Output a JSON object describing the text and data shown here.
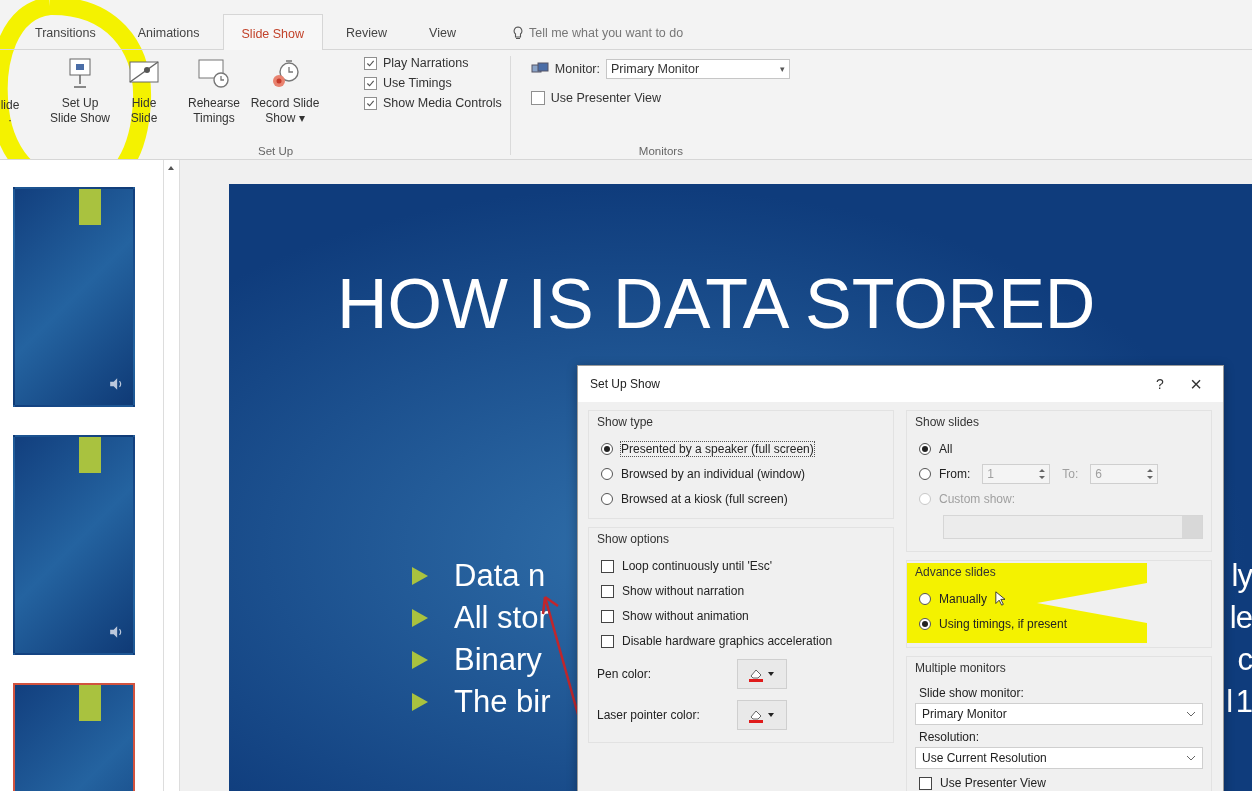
{
  "ribbon": {
    "tabs": [
      {
        "label": "Transitions",
        "selected": false
      },
      {
        "label": "Animations",
        "selected": false
      },
      {
        "label": "Slide Show",
        "selected": true
      },
      {
        "label": "Review",
        "selected": false
      },
      {
        "label": "View",
        "selected": false
      }
    ],
    "tell_me": {
      "placeholder": "Tell me what you want to do"
    },
    "buttons": [
      {
        "kind": "cut",
        "lines": [
          "lide",
          "·"
        ]
      },
      {
        "kind": "setup",
        "lines": [
          "Set Up",
          "Slide Show"
        ]
      },
      {
        "kind": "hide",
        "lines": [
          "Hide",
          "Slide"
        ]
      },
      {
        "kind": "rehearse",
        "lines": [
          "Rehearse",
          "Timings"
        ]
      },
      {
        "kind": "record",
        "lines": [
          "Record Slide",
          "Show ▾"
        ]
      }
    ],
    "checkboxes": [
      {
        "label": "Play Narrations",
        "checked": true
      },
      {
        "label": "Use Timings",
        "checked": true
      },
      {
        "label": "Show Media Controls",
        "checked": true
      }
    ],
    "setup_group_label": "Set Up",
    "monitor": {
      "label": "Monitor:",
      "value": "Primary Monitor",
      "caret": "▾"
    },
    "presenter_view": {
      "label": "Use Presenter View",
      "checked": false
    },
    "monitors_group_label": "Monitors"
  },
  "thumbnails": [
    {
      "selected": false,
      "has_audio": true
    },
    {
      "selected": false,
      "has_audio": true
    },
    {
      "selected": true,
      "has_audio": false
    }
  ],
  "slide": {
    "title": "HOW IS DATA STORED",
    "bullets": [
      {
        "text": "Data n",
        "tail": "ly"
      },
      {
        "text": "All stor",
        "tail": "le"
      },
      {
        "text": "Binary",
        "tail": "c"
      },
      {
        "text": "The bir",
        "tail": "l 1"
      }
    ]
  },
  "dialog": {
    "title": "Set Up Show",
    "help": "?",
    "close": "×",
    "show_type": {
      "title": "Show type",
      "options": [
        {
          "label": "Presented by a speaker (full screen)",
          "selected": true
        },
        {
          "label": "Browsed by an individual (window)",
          "selected": false
        },
        {
          "label": "Browsed at a kiosk (full screen)",
          "selected": false
        }
      ]
    },
    "show_options": {
      "title": "Show options",
      "checkboxes": [
        {
          "label": "Loop continuously until 'Esc'",
          "checked": false
        },
        {
          "label": "Show without narration",
          "checked": false
        },
        {
          "label": "Show without animation",
          "checked": false
        },
        {
          "label": "Disable hardware graphics acceleration",
          "checked": false
        }
      ],
      "colors": [
        {
          "label": "Pen color:"
        },
        {
          "label": "Laser pointer color:"
        }
      ]
    },
    "show_slides": {
      "title": "Show slides",
      "options": [
        {
          "kind": "plain",
          "label": "All",
          "selected": true,
          "disabled": false
        },
        {
          "kind": "range",
          "label": "From:",
          "selected": false,
          "disabled": false,
          "from": "1",
          "to_label": "To:",
          "to": "6"
        },
        {
          "kind": "custom",
          "label": "Custom show:",
          "selected": false,
          "disabled": true
        }
      ]
    },
    "advance_slides": {
      "title": "Advance slides",
      "options": [
        {
          "label": "Manually",
          "selected": false
        },
        {
          "label": "Using timings, if present",
          "selected": true
        }
      ]
    },
    "multiple_monitors": {
      "title": "Multiple monitors",
      "fields": [
        {
          "label": "Slide show monitor:",
          "value": "Primary Monitor"
        },
        {
          "label": "Resolution:",
          "value": "Use Current Resolution"
        }
      ],
      "presenter_view": {
        "label": "Use Presenter View",
        "checked": false
      }
    }
  }
}
